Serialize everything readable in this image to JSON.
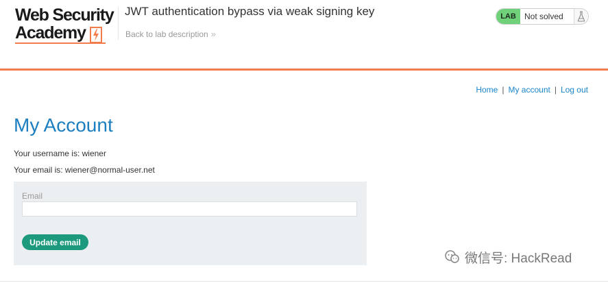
{
  "header": {
    "logo": {
      "line1": "Web Security",
      "line2": "Academy"
    },
    "lab_title": "JWT authentication bypass via weak signing key",
    "back_link": "Back to lab description",
    "lab_badge": "LAB",
    "lab_status": "Not solved",
    "accent_color": "#f47c4c"
  },
  "nav": {
    "home": "Home",
    "separator": "|",
    "my_account": "My account",
    "log_out": "Log out"
  },
  "main": {
    "title": "My Account",
    "username_text": "Your username is: wiener",
    "email_text": "Your email is: wiener@normal-user.net",
    "form": {
      "email_label": "Email",
      "email_value": "",
      "update_button": "Update email",
      "button_color": "#1d9a7d"
    }
  },
  "watermark": {
    "text": "微信号: HackRead"
  }
}
